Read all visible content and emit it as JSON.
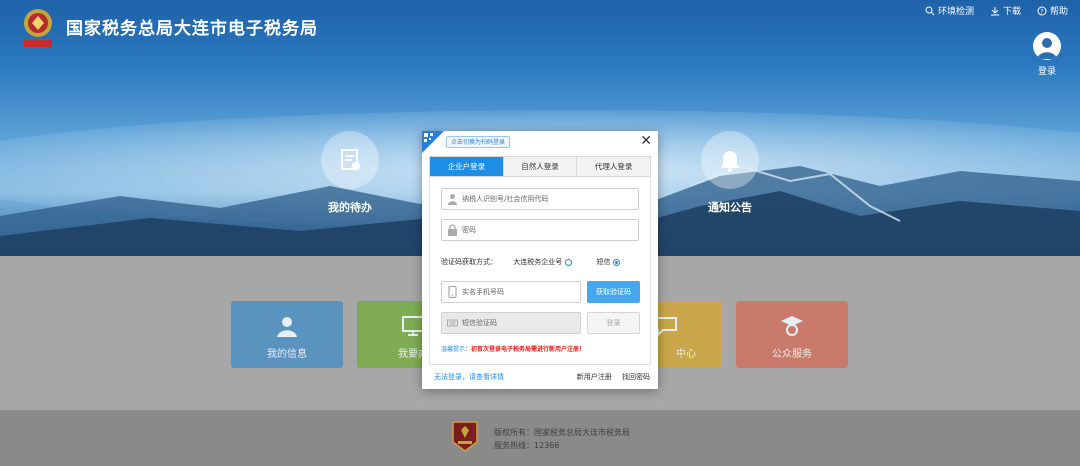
{
  "header": {
    "title": "国家税务总局大连市电子税务局",
    "links": [
      {
        "label": "环境检测",
        "icon": "search-icon"
      },
      {
        "label": "下载",
        "icon": "download-icon"
      },
      {
        "label": "帮助",
        "icon": "help-icon"
      }
    ],
    "login_label": "登录"
  },
  "hero": {
    "left_card": "我的待办",
    "right_card": "通知公告"
  },
  "tiles": [
    {
      "label": "我的信息",
      "color": "#5b93bf",
      "icon": "user-icon"
    },
    {
      "label": "我要办",
      "color": "#7fab55",
      "icon": "monitor-icon"
    },
    {
      "label": "中心",
      "color": "#c9a64a",
      "icon": "chat-icon"
    },
    {
      "label": "公众服务",
      "color": "#c97a6a",
      "icon": "graduate-icon"
    }
  ],
  "modal": {
    "qr_tip": "点击切换为扫码登录",
    "tabs": [
      "企业户登录",
      "自然人登录",
      "代理人登录"
    ],
    "active_tab": 0,
    "taxpayer_placeholder": "纳税人识别号/社会信用代码",
    "password_placeholder": "密码",
    "verify_label": "验证码获取方式：",
    "verify_option1": "大连税务企业号",
    "verify_option2": "短信",
    "phone_placeholder": "实名手机号码",
    "get_code_button": "获取验证码",
    "sms_placeholder": "短信验证码",
    "login_button": "登录",
    "tip_label": "温馨提示：",
    "tip_message": "初首次登录电子税务局需进行新用户注册！",
    "help_link": "无法登录，请查看详情",
    "register_link": "新用户注册",
    "forgot_link": "找回密码"
  },
  "footer": {
    "copyright": "版权所有：国家税务总局大连市税务局",
    "hotline": "服务热线：12366"
  },
  "colors": {
    "primary": "#1d8ee6",
    "tip_red": "#e02020"
  }
}
